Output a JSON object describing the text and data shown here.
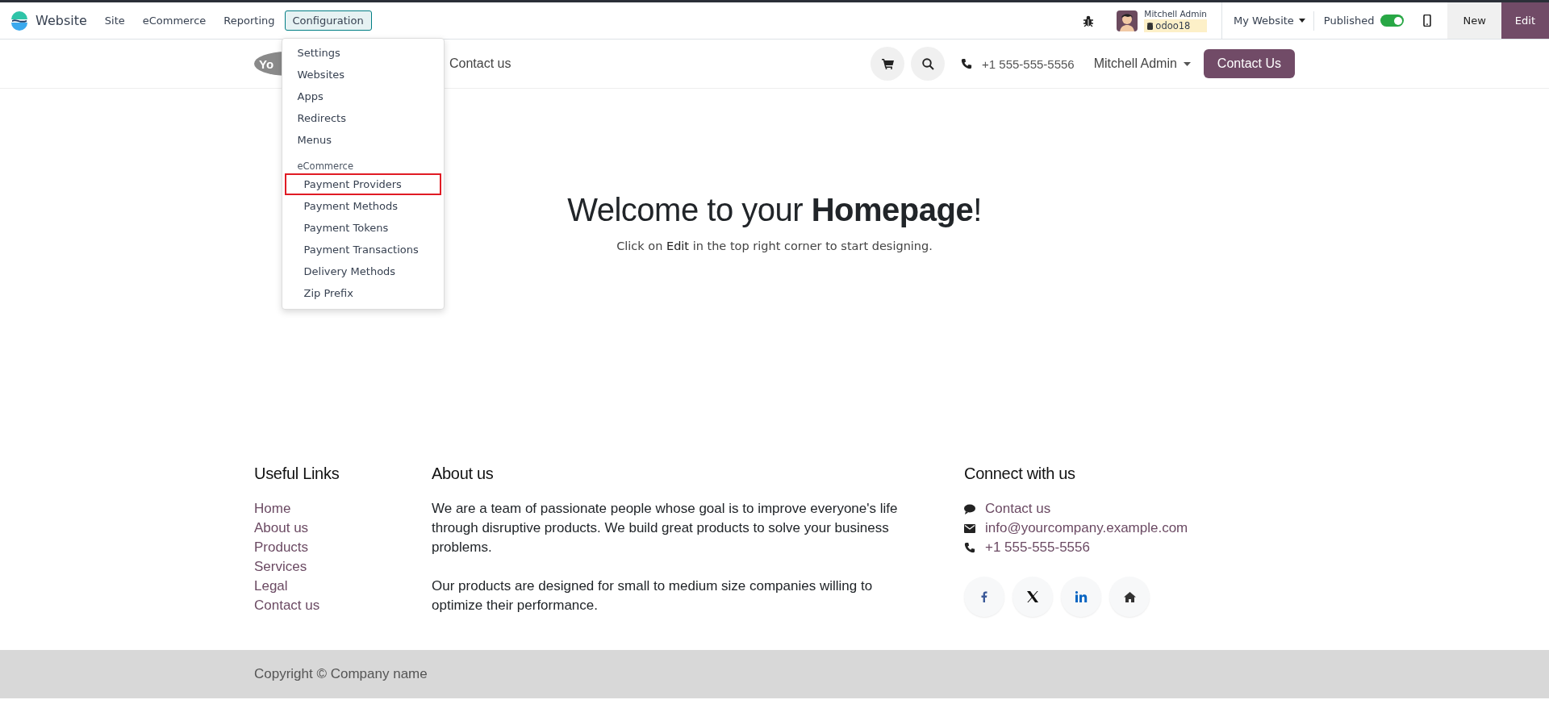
{
  "navbar": {
    "app_name": "Website",
    "menus": [
      {
        "label": "Site",
        "selected": false
      },
      {
        "label": "eCommerce",
        "selected": false
      },
      {
        "label": "Reporting",
        "selected": false
      },
      {
        "label": "Configuration",
        "selected": true
      }
    ],
    "user": {
      "name": "Mitchell Admin",
      "database": "odoo18"
    },
    "website_selector": "My Website",
    "published": {
      "label": "Published",
      "on": true
    },
    "buttons": [
      {
        "label": "New",
        "kind": "secondary"
      },
      {
        "label": "Edit",
        "kind": "primary"
      }
    ]
  },
  "dropdown": {
    "items": [
      {
        "kind": "item",
        "label": "Settings",
        "highlighted": false
      },
      {
        "kind": "item",
        "label": "Websites",
        "highlighted": false
      },
      {
        "kind": "item",
        "label": "Apps",
        "highlighted": false
      },
      {
        "kind": "item",
        "label": "Redirects",
        "highlighted": false
      },
      {
        "kind": "item",
        "label": "Menus",
        "highlighted": false
      },
      {
        "kind": "header",
        "label": "eCommerce"
      },
      {
        "kind": "subitem",
        "label": "Payment Providers",
        "highlighted": true
      },
      {
        "kind": "subitem",
        "label": "Payment Methods",
        "highlighted": false
      },
      {
        "kind": "subitem",
        "label": "Payment Tokens",
        "highlighted": false
      },
      {
        "kind": "subitem",
        "label": "Payment Transactions",
        "highlighted": false
      },
      {
        "kind": "subitem",
        "label": "Delivery Methods",
        "highlighted": false
      },
      {
        "kind": "subitem",
        "label": "Zip Prefix",
        "highlighted": false
      }
    ]
  },
  "site_header": {
    "logo_text": "Yo",
    "nav": [
      "Contact us"
    ],
    "phone": "+1 555-555-5556",
    "user": "Mitchell Admin",
    "cta": "Contact Us"
  },
  "hero": {
    "title": "Welcome to your **Homepage**!",
    "subtitle": "Click on **Edit** in the top right corner to start designing."
  },
  "footer": {
    "links_title": "Useful Links",
    "links": [
      "Home",
      "About us",
      "Products",
      "Services",
      "Legal",
      "Contact us"
    ],
    "about_title": "About us",
    "about_paragraphs": [
      "We are a team of passionate people whose goal is to improve everyone's life through disruptive products. We build great products to solve your business problems.",
      "Our products are designed for small to medium size companies willing to optimize their performance."
    ],
    "connect_title": "Connect with us",
    "contacts": [
      {
        "kind": "chat",
        "text": "Contact us"
      },
      {
        "kind": "email",
        "text": "info@yourcompany.example.com"
      },
      {
        "kind": "phone",
        "text": "+1 555-555-5556"
      }
    ],
    "socials": [
      {
        "kind": "facebook"
      },
      {
        "kind": "x"
      },
      {
        "kind": "linkedin"
      },
      {
        "kind": "home"
      }
    ]
  },
  "copyright": "Copyright © Company name"
}
